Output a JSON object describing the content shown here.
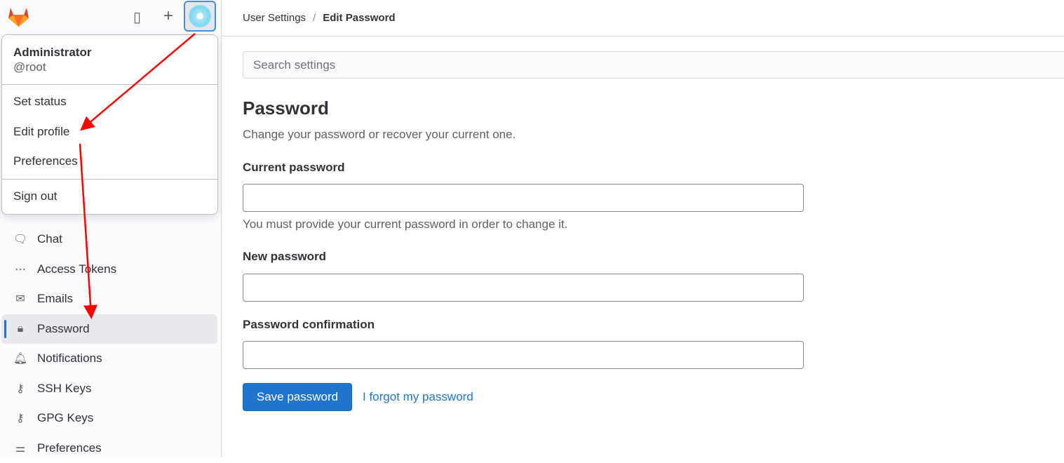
{
  "header": {
    "avatar_alt": "Administrator avatar"
  },
  "user_menu": {
    "name": "Administrator",
    "username": "@root",
    "items": [
      "Set status",
      "Edit profile",
      "Preferences"
    ],
    "sign_out": "Sign out"
  },
  "sidebar": {
    "items": [
      {
        "label": "Chat",
        "icon": "comment-icon"
      },
      {
        "label": "Access Tokens",
        "icon": "token-icon"
      },
      {
        "label": "Emails",
        "icon": "mail-icon"
      },
      {
        "label": "Password",
        "icon": "lock-icon",
        "active": true
      },
      {
        "label": "Notifications",
        "icon": "bell-icon"
      },
      {
        "label": "SSH Keys",
        "icon": "key-icon"
      },
      {
        "label": "GPG Keys",
        "icon": "key-icon"
      },
      {
        "label": "Preferences",
        "icon": "preferences-icon"
      }
    ]
  },
  "breadcrumb": {
    "parent": "User Settings",
    "separator": "/",
    "current": "Edit Password"
  },
  "search": {
    "placeholder": "Search settings"
  },
  "page": {
    "title": "Password",
    "description": "Change your password or recover your current one.",
    "current_label": "Current password",
    "current_help": "You must provide your current password in order to change it.",
    "new_label": "New password",
    "confirm_label": "Password confirmation",
    "save_label": "Save password",
    "forgot_label": "I forgot my password"
  },
  "colors": {
    "accent": "#1f75cb",
    "annotation": "#ff0000"
  }
}
